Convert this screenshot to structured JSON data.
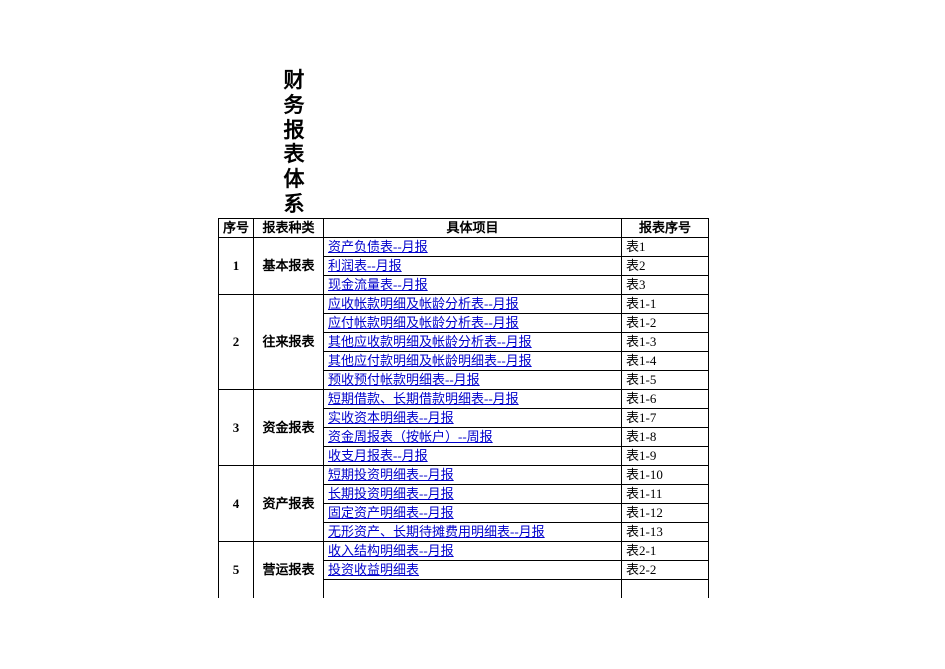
{
  "title_chars": [
    "财",
    "务",
    "报",
    "表",
    "体",
    "系"
  ],
  "headers": {
    "seq": "序号",
    "type": "报表种类",
    "item": "具体项目",
    "num": "报表序号"
  },
  "groups": [
    {
      "seq": "1",
      "type": "基本报表",
      "rows": [
        {
          "item": "资产负债表--月报",
          "link": true,
          "num": "表1"
        },
        {
          "item": "利润表--月报",
          "link": true,
          "num": "表2"
        },
        {
          "item": "现金流量表--月报",
          "link": true,
          "num": "表3"
        }
      ]
    },
    {
      "seq": "2",
      "type": "往来报表",
      "rows": [
        {
          "item": "应收帐款明细及帐龄分析表--月报",
          "link": true,
          "num": "表1-1"
        },
        {
          "item": "应付帐款明细及帐龄分析表--月报",
          "link": true,
          "num": "表1-2"
        },
        {
          "item": "其他应收款明细及帐龄分析表--月报",
          "link": true,
          "num": "表1-3"
        },
        {
          "item": "其他应付款明细及帐龄明细表--月报",
          "link": true,
          "num": "表1-4"
        },
        {
          "item": "预收预付帐款明细表--月报",
          "link": true,
          "num": "表1-5"
        }
      ]
    },
    {
      "seq": "3",
      "type": "资金报表",
      "rows": [
        {
          "item": "短期借款、长期借款明细表--月报",
          "link": true,
          "num": "表1-6"
        },
        {
          "item": "实收资本明细表--月报",
          "link": true,
          "num": "表1-7"
        },
        {
          "item": "资金周报表（按帐户）--周报",
          "link": true,
          "num": "表1-8"
        },
        {
          "item": "收支月报表--月报",
          "link": true,
          "num": "表1-9"
        }
      ]
    },
    {
      "seq": "4",
      "type": "资产报表",
      "rows": [
        {
          "item": "短期投资明细表--月报",
          "link": true,
          "num": "表1-10"
        },
        {
          "item": "长期投资明细表--月报",
          "link": true,
          "num": "表1-11"
        },
        {
          "item": "固定资产明细表--月报",
          "link": true,
          "num": "表1-12"
        },
        {
          "item": "无形资产、长期待摊费用明细表--月报",
          "link": true,
          "num": "表1-13"
        }
      ]
    },
    {
      "seq": "5",
      "type": "营运报表",
      "open": true,
      "rows": [
        {
          "item": "收入结构明细表--月报",
          "link": true,
          "num": "表2-1"
        },
        {
          "item": "投资收益明细表",
          "link": true,
          "num": "表2-2"
        },
        {
          "item": "",
          "link": false,
          "num": ""
        }
      ]
    }
  ]
}
